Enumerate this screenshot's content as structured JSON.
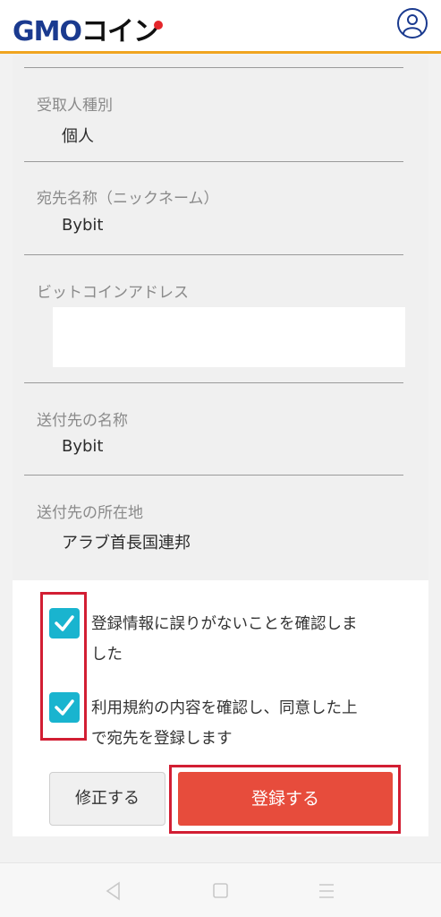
{
  "header": {
    "logo_latin": "GMO",
    "logo_jp": "コイン",
    "account_icon": "user-circle-icon"
  },
  "fields": [
    {
      "label": "受取人種別",
      "value": "個人"
    },
    {
      "label": "宛先名称（ニックネーム）",
      "value": "Bybit"
    },
    {
      "label": "ビットコインアドレス",
      "value": ""
    },
    {
      "label": "送付先の名称",
      "value": "Bybit"
    },
    {
      "label": "送付先の所在地",
      "value": "アラブ首長国連邦"
    }
  ],
  "confirmations": [
    {
      "line1": "登録情報に誤りがないことを確認しま",
      "line2": "した",
      "checked": true
    },
    {
      "line1": "利用規約の内容を確認し、同意した上",
      "line2": "で宛先を登録します",
      "checked": true
    }
  ],
  "buttons": {
    "fix_label": "修正する",
    "register_label": "登録する"
  },
  "colors": {
    "brand_blue": "#1a3a8f",
    "header_border": "#f0a520",
    "checkbox": "#19b4cf",
    "register_button": "#e74c3c",
    "highlight": "#d21e33"
  },
  "navbar": {
    "icons": [
      "back-icon",
      "home-icon",
      "menu-icon"
    ]
  }
}
